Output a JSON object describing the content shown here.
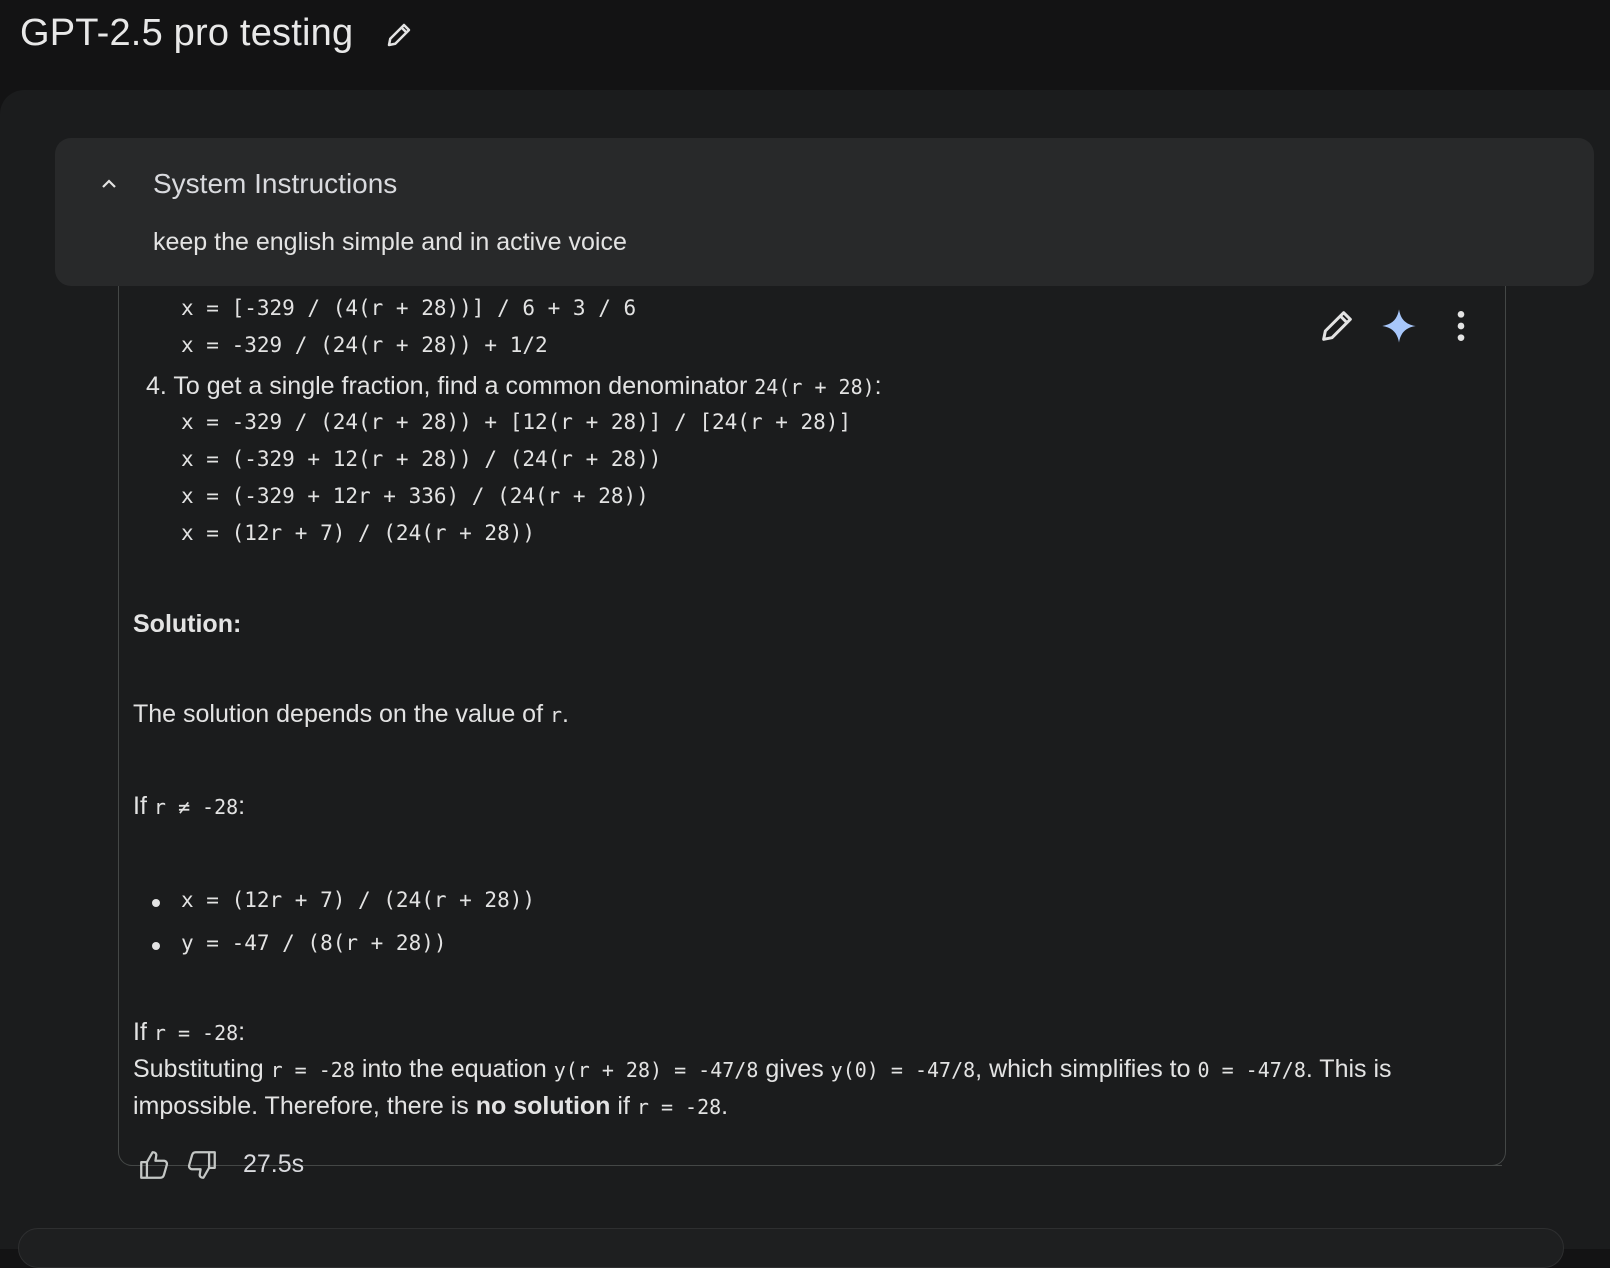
{
  "header": {
    "title": "GPT-2.5 pro testing",
    "edit_icon": "pencil-icon"
  },
  "system_instructions": {
    "title": "System Instructions",
    "text": "keep the english simple and in active voice",
    "collapse_icon": "chevron-up-icon"
  },
  "response": {
    "steps_before": [
      "x = [-329 / (4(r + 28))] / 6 + 3 / 6",
      "x = -329 / (24(r + 28)) + 1/2"
    ],
    "step4": {
      "number": "4.",
      "text": "To get a single fraction, find a common denominator",
      "denominator": "24(r + 28)",
      "colon": ":"
    },
    "step4_lines": [
      "x = -329 / (24(r + 28)) + [12(r + 28)] / [24(r + 28)]",
      "x = (-329 + 12(r + 28)) / (24(r + 28))",
      "x = (-329 + 12r + 336) / (24(r + 28))",
      "x = (12r + 7) / (24(r + 28))"
    ],
    "solution_heading": "Solution:",
    "depends_text": "The solution depends on the value of",
    "depends_var": "r",
    "depends_end": ".",
    "case1": {
      "if": "If",
      "cond": "r ≠ -28",
      "colon": ":",
      "bullets": [
        "x = (12r + 7) / (24(r + 28))",
        "y = -47 / (8(r + 28))"
      ]
    },
    "case2": {
      "if": "If",
      "cond": "r = -28",
      "colon": ":",
      "line1_a": "Substituting",
      "line1_code1": "r = -28",
      "line1_b": "into the equation",
      "line1_code2": "y(r + 28) = -47/8",
      "line1_c": "gives",
      "line1_code3": "y(0) = -47/8",
      "line1_d": ", which simplifies to",
      "line1_code4": "0 = -47/8",
      "line1_e": ". This is",
      "line2_a": "impossible. Therefore, there is",
      "line2_bold": "no solution",
      "line2_b": "if",
      "line2_code": "r = -28",
      "line2_end": "."
    }
  },
  "actions": {
    "edit_icon": "pencil-icon",
    "rerun_icon": "sparkle-icon",
    "more_icon": "more-vert-icon"
  },
  "footer": {
    "thumbs_up_icon": "thumbs-up-icon",
    "thumbs_down_icon": "thumbs-down-icon",
    "time": "27.5s"
  },
  "colors": {
    "background": "#131314",
    "panel": "#1b1c1d",
    "system_box": "#28292a",
    "sparkle": "#a8c7fa",
    "text": "#e3e3e3"
  }
}
